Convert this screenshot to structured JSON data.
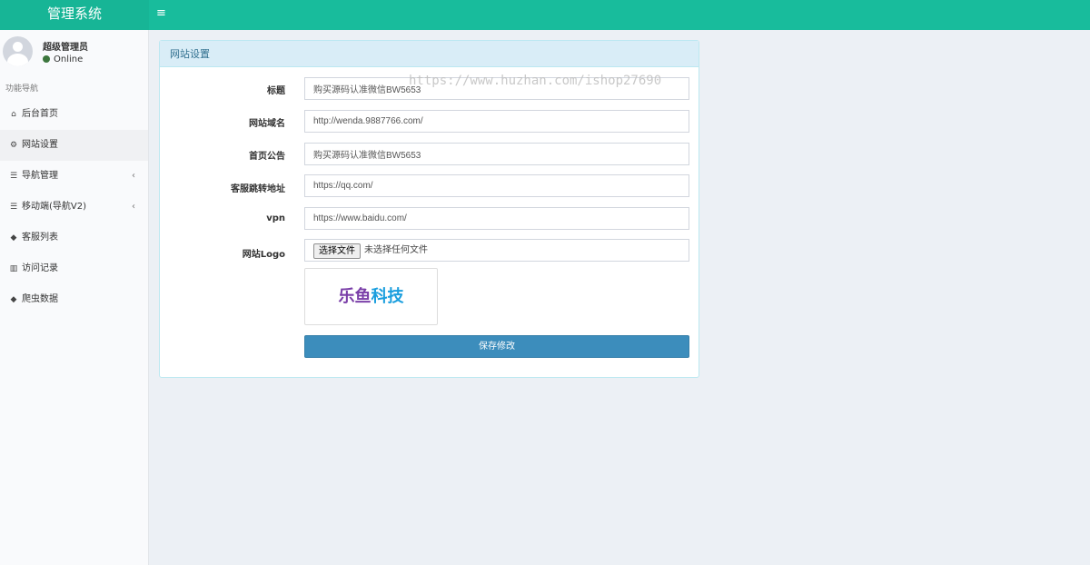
{
  "header": {
    "brand": "管理系统",
    "menu_toggle_icon": "hamburger-icon",
    "brand_color": "#18bc9c"
  },
  "user": {
    "name": "超级管理员",
    "status": "Online",
    "status_color": "#3c763d"
  },
  "sidebar": {
    "header": "功能导航",
    "items": [
      {
        "label": "后台首页",
        "icon": "home-icon",
        "glyph": "⌂"
      },
      {
        "label": "网站设置",
        "icon": "gears-icon",
        "glyph": "⚙",
        "active": true
      },
      {
        "label": "导航管理",
        "icon": "database-icon",
        "glyph": "☰",
        "caret": "‹"
      },
      {
        "label": "移动端(导航V2)",
        "icon": "database-icon",
        "glyph": "☰",
        "caret": "‹"
      },
      {
        "label": "客服列表",
        "icon": "tags-icon",
        "glyph": "◆"
      },
      {
        "label": "访问记录",
        "icon": "bar-chart-icon",
        "glyph": "▥"
      },
      {
        "label": "爬虫数据",
        "icon": "tags-icon",
        "glyph": "◆"
      }
    ]
  },
  "panel": {
    "title": "网站设置",
    "fields": {
      "title": {
        "label": "标题",
        "value": "购买源码认准微信BW5653"
      },
      "domain": {
        "label": "网站域名",
        "value": "http://wenda.9887766.com/"
      },
      "notice": {
        "label": "首页公告",
        "value": "购买源码认准微信BW5653"
      },
      "service_url": {
        "label": "客服跳转地址",
        "value": "https://qq.com/"
      },
      "vpn": {
        "label": "vpn",
        "value": "https://www.baidu.com/"
      },
      "logo": {
        "label": "网站Logo",
        "button": "选择文件",
        "status": "未选择任何文件"
      }
    },
    "logo_preview": {
      "part1": "乐鱼",
      "part2": "科技",
      "color1": "#7a3ea8",
      "color2": "#1a9ede"
    },
    "save_button": "保存修改"
  },
  "watermark": "https://www.huzhan.com/ishop27690"
}
